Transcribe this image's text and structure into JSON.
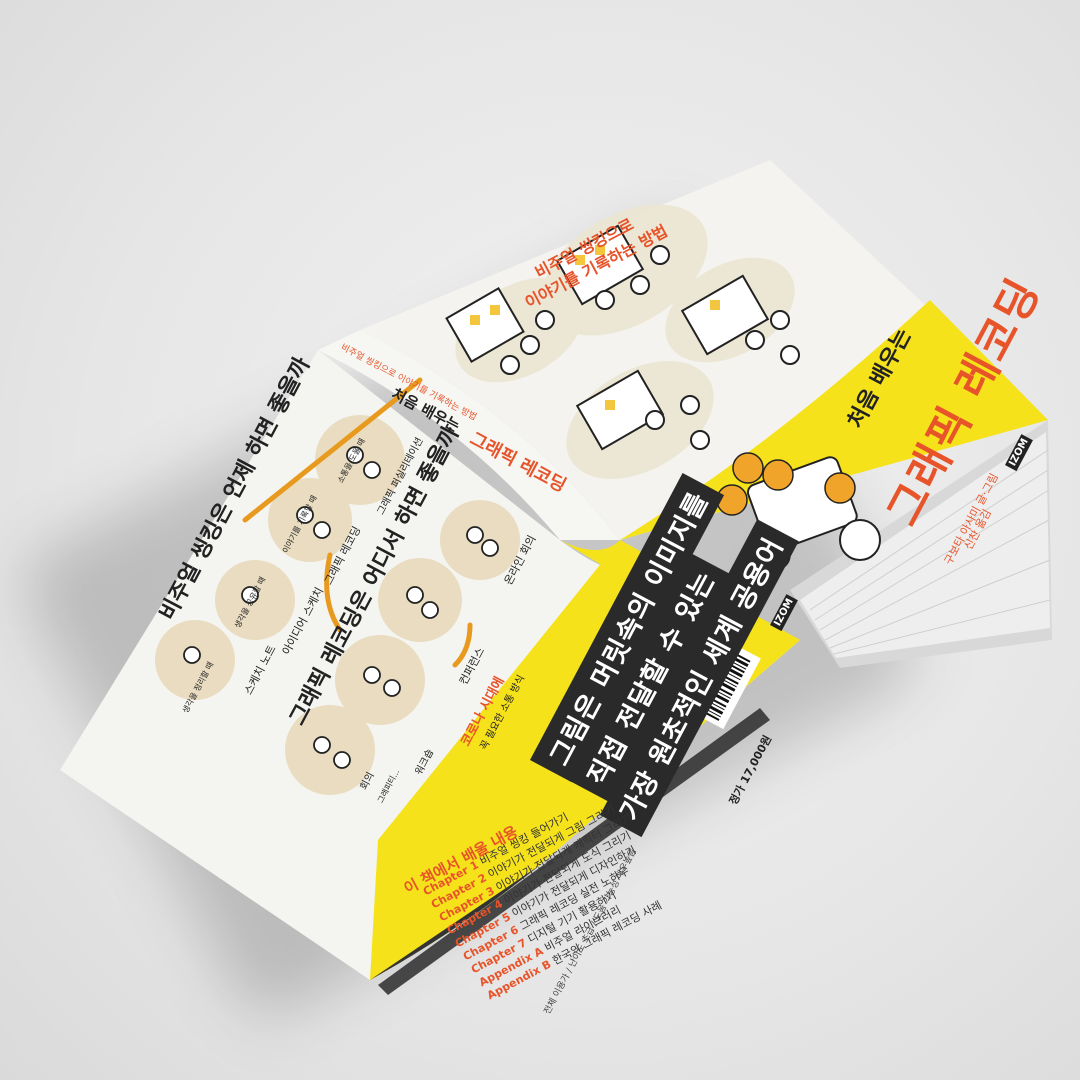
{
  "front_cover": {
    "subtitle_line1": "비주얼 씽킹으로",
    "subtitle_line2": "이야기를 기록하는 방법",
    "series_label": "처음 배우는",
    "title": "그래픽 레코딩",
    "authors": "구보타 아사미 글·그림",
    "translator": "신찬 옮김",
    "publisher_mark": "IZOM"
  },
  "spine": {
    "tagline": "비주얼 씽킹으로 이야기를 기록하는 방법",
    "series_label": "처음 배우는",
    "title": "그래픽 레코딩"
  },
  "back_cover": {
    "illustration_text": {
      "heading1": "비주얼 씽킹은 언제 하면 좋을까",
      "heading2": "그래픽 레코딩은 어디서 하면 좋을까",
      "note_sketchnote": "스케치 노트",
      "note_idea": "아이디어 스케치",
      "note_graphic_recording": "그래픽 레코딩",
      "note_graphic_facilitation": "그래픽 퍼실리테이션",
      "note_conference": "컨퍼런스",
      "note_workshop": "워크숍",
      "note_meeting": "회의",
      "note_online": "온라인 회의",
      "note_corona": "코로나 시대에",
      "note_corona2": "꼭 필요한 소통 방식",
      "note_small1": "생각을 정리할 때",
      "note_small2": "생각을 공유할 때",
      "note_small3": "이야기를 기록할 때",
      "note_small4": "소통을 도울 때",
      "note_small5": "그래피티..."
    },
    "highlight_lines": [
      "그림은 머릿속의 이미지를",
      "직접 전달할 수 있는",
      "가장 원초적인 세계 공용어"
    ],
    "toc_title": "이 책에서 배울 내용",
    "toc": [
      {
        "label": "Chapter 1",
        "text": "비주얼 씽킹 들어가기"
      },
      {
        "label": "Chapter 2",
        "text": "이야기가 전달되게 그림 그리기"
      },
      {
        "label": "Chapter 3",
        "text": "이야기가 전달되게 캐릭터 그리기"
      },
      {
        "label": "Chapter 4",
        "text": "이야기가 전달되게 도식 그리기"
      },
      {
        "label": "Chapter 5",
        "text": "이야기가 전달되게 디자인하기"
      },
      {
        "label": "Chapter 6",
        "text": "그래픽 레코딩 실전 노하우"
      },
      {
        "label": "Chapter 7",
        "text": "디지털 기기 활용하기"
      },
      {
        "label": "Appendix A",
        "text": "비주얼 라이브러리"
      },
      {
        "label": "Appendix B",
        "text": "한국의 그래픽 레코딩 사례"
      }
    ],
    "footer_line": "전체 이용가 / 난이도 초급 / 도움 가능성 매우높음",
    "price": "정가 17,000원",
    "publisher_mark": "IZOM"
  },
  "colors": {
    "yellow": "#f5e21b",
    "orange": "#e8542a",
    "dark": "#2a2a2a",
    "paper": "#f4f4f0",
    "beige": "#e9dcc0",
    "background": "#e6e6e6"
  }
}
